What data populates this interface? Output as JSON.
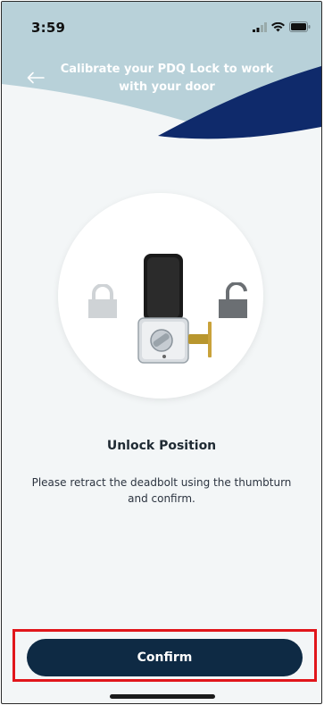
{
  "status_bar": {
    "time": "3:59"
  },
  "header": {
    "title": "Calibrate your PDQ Lock to work with your door",
    "back_icon": "arrow-left-icon"
  },
  "illustration": {
    "left_icon": "locked-padlock-icon",
    "center": "deadbolt-lock-illustration",
    "right_icon": "unlocked-padlock-icon"
  },
  "content": {
    "heading": "Unlock Position",
    "instruction": "Please retract the deadbolt using the thumbturn and confirm."
  },
  "actions": {
    "confirm_label": "Confirm"
  },
  "colors": {
    "accent_navy": "#0e2a44",
    "header_light": "#b8d1d9",
    "header_dark": "#0f2a6b",
    "highlight_red": "#e1161b"
  }
}
